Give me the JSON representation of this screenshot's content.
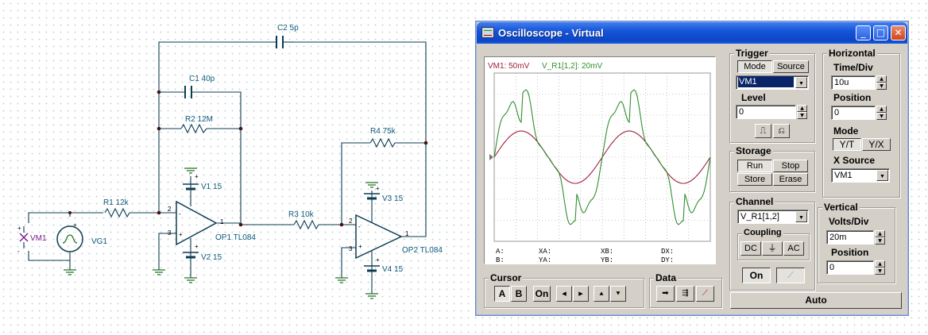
{
  "schematic": {
    "components": {
      "c2": "C2 5p",
      "c1": "C1 40p",
      "r2": "R2 12M",
      "r4": "R4 75k",
      "r1": "R1 12k",
      "r3": "R3 10k",
      "v1": "V1 15",
      "v2": "V2 15",
      "v3": "V3 15",
      "v4": "V4 15",
      "op1": "OP1 TL084",
      "op2": "OP2 TL084",
      "vg1": "VG1",
      "vm1": "VM1"
    },
    "pins": {
      "two": "2",
      "three": "3",
      "one": "1",
      "plus": "+",
      "minus": "-"
    }
  },
  "window": {
    "title": "Oscilloscope - Virtual",
    "minimize": "_",
    "maximize": "□",
    "close": "✕"
  },
  "scope": {
    "legend_vm1": "VM1: 50mV",
    "legend_vr1": "V_R1[1,2]: 20mV",
    "colors": {
      "vm1": "#a01f3a",
      "vr1": "#2f8f2f",
      "grid": "#9a9a9a"
    },
    "readouts": {
      "a": "A:",
      "b": "B:",
      "xa": "XA:",
      "ya": "YA:",
      "xb": "XB:",
      "yb": "YB:",
      "dx": "DX:",
      "dy": "DY:"
    }
  },
  "trigger": {
    "title": "Trigger",
    "mode_label": "Mode",
    "source_label": "Source",
    "source_value": "VM1",
    "level_label": "Level",
    "level_value": "0",
    "rising_icon": "rising-edge-icon",
    "falling_icon": "falling-edge-icon"
  },
  "horizontal": {
    "title": "Horizontal",
    "time_div_label": "Time/Div",
    "time_div_value": "10u",
    "position_label": "Position",
    "position_value": "0",
    "mode_label": "Mode",
    "mode_yt": "Y/T",
    "mode_xy": "Y/X",
    "xsource_label": "X Source",
    "xsource_value": "VM1"
  },
  "storage": {
    "title": "Storage",
    "run": "Run",
    "stop": "Stop",
    "store": "Store",
    "erase": "Erase"
  },
  "channel": {
    "title": "Channel",
    "value": "V_R1[1,2]",
    "coupling_title": "Coupling",
    "dc": "DC",
    "gnd": "⏚",
    "ac": "AC",
    "on": "On",
    "probe_icon": "probe-icon"
  },
  "vertical": {
    "title": "Vertical",
    "volts_div_label": "Volts/Div",
    "volts_div_value": "20m",
    "position_label": "Position",
    "position_value": "0"
  },
  "cursor": {
    "title": "Cursor",
    "a": "A",
    "b": "B",
    "on": "On",
    "left": "◂",
    "right": "▸",
    "up": "⯅",
    "down": "⯆"
  },
  "data": {
    "title": "Data"
  },
  "auto": "Auto"
}
